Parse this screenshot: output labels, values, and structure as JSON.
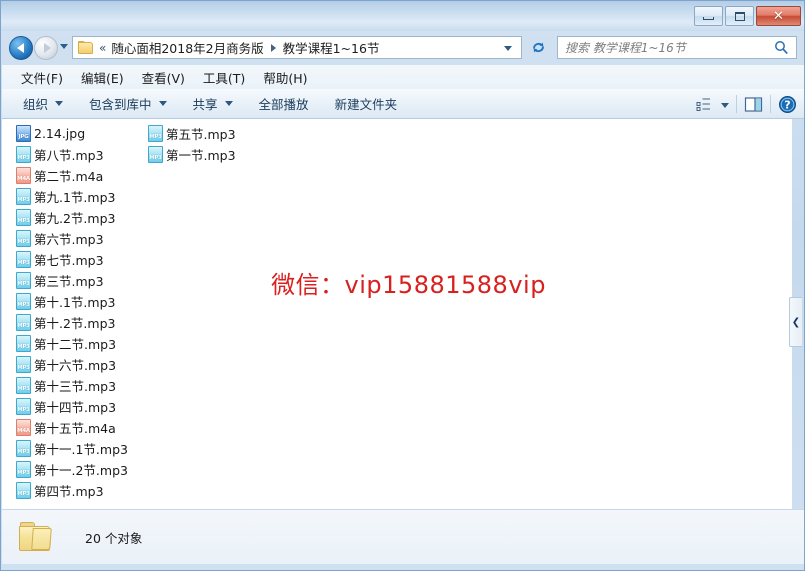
{
  "window": {
    "title": "",
    "controls": {
      "minimize": "minimize",
      "maximize": "maximize",
      "close": "✕"
    }
  },
  "address_bar": {
    "back_icon": "back-arrow-icon",
    "forward_icon": "forward-arrow-icon",
    "history_icon": "history-dropdown-icon",
    "folder_icon": "folder-icon",
    "separator_double": "«",
    "crumbs": [
      "随心面相2018年2月商务版",
      "教学课程1~16节"
    ],
    "dropdown_icon": "chevron-down-icon",
    "refresh_icon": "refresh-icon",
    "refresh_glyph": "↻"
  },
  "search": {
    "placeholder": "搜索 教学课程1~16节",
    "icon": "search-icon"
  },
  "menu": {
    "items": [
      "文件(F)",
      "编辑(E)",
      "查看(V)",
      "工具(T)",
      "帮助(H)"
    ]
  },
  "toolbar": {
    "items": [
      {
        "label": "组织",
        "has_caret": true
      },
      {
        "label": "包含到库中",
        "has_caret": true
      },
      {
        "label": "共享",
        "has_caret": true
      },
      {
        "label": "全部播放",
        "has_caret": false
      },
      {
        "label": "新建文件夹",
        "has_caret": false
      }
    ],
    "right_icons": [
      "view-mode-icon",
      "view-mode-caret-icon",
      "preview-pane-icon",
      "help-icon"
    ],
    "help_glyph": "?"
  },
  "files": {
    "column1": [
      {
        "name": "2.14.jpg",
        "type": "jpg",
        "badge": "JPG"
      },
      {
        "name": "第八节.mp3",
        "type": "mp3",
        "badge": "MP3"
      },
      {
        "name": "第二节.m4a",
        "type": "m4a",
        "badge": "M4A"
      },
      {
        "name": "第九.1节.mp3",
        "type": "mp3",
        "badge": "MP3"
      },
      {
        "name": "第九.2节.mp3",
        "type": "mp3",
        "badge": "MP3"
      },
      {
        "name": "第六节.mp3",
        "type": "mp3",
        "badge": "MP3"
      },
      {
        "name": "第七节.mp3",
        "type": "mp3",
        "badge": "MP3"
      },
      {
        "name": "第三节.mp3",
        "type": "mp3",
        "badge": "MP3"
      },
      {
        "name": "第十.1节.mp3",
        "type": "mp3",
        "badge": "MP3"
      },
      {
        "name": "第十.2节.mp3",
        "type": "mp3",
        "badge": "MP3"
      },
      {
        "name": "第十二节.mp3",
        "type": "mp3",
        "badge": "MP3"
      },
      {
        "name": "第十六节.mp3",
        "type": "mp3",
        "badge": "MP3"
      },
      {
        "name": "第十三节.mp3",
        "type": "mp3",
        "badge": "MP3"
      },
      {
        "name": "第十四节.mp3",
        "type": "mp3",
        "badge": "MP3"
      },
      {
        "name": "第十五节.m4a",
        "type": "m4a",
        "badge": "M4A"
      },
      {
        "name": "第十一.1节.mp3",
        "type": "mp3",
        "badge": "MP3"
      },
      {
        "name": "第十一.2节.mp3",
        "type": "mp3",
        "badge": "MP3"
      },
      {
        "name": "第四节.mp3",
        "type": "mp3",
        "badge": "MP3"
      }
    ],
    "column2": [
      {
        "name": "第五节.mp3",
        "type": "mp3",
        "badge": "MP3"
      },
      {
        "name": "第一节.mp3",
        "type": "mp3",
        "badge": "MP3"
      }
    ]
  },
  "watermark": {
    "text": "微信：vip15881588vip",
    "color": "#d8201f"
  },
  "side_panel": {
    "collapse_glyph": "❮",
    "icon": "chevron-left-icon"
  },
  "status_bar": {
    "folder_icon": "folder-large-icon",
    "text": "20 个对象"
  }
}
